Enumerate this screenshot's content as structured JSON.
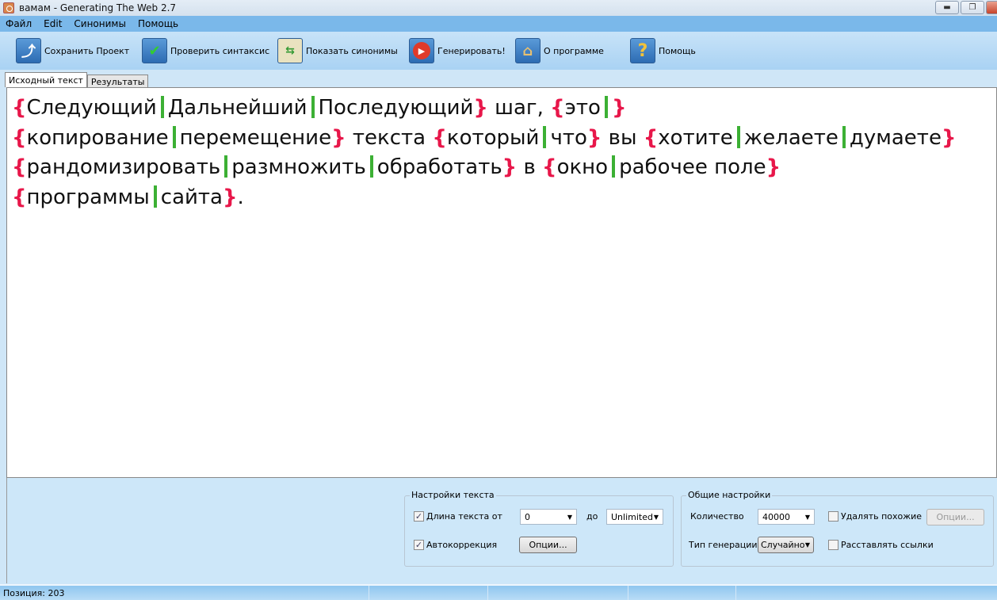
{
  "window": {
    "title": "вамам - Generating The Web 2.7"
  },
  "menu": [
    "Файл",
    "Edit",
    "Синонимы",
    "Помощь"
  ],
  "toolbar": [
    {
      "label": "Сохранить Проект",
      "icon": "save-icon"
    },
    {
      "label": "Проверить синтаксис",
      "icon": "checkmark-icon"
    },
    {
      "label": "Показать синонимы",
      "icon": "swap-documents-icon"
    },
    {
      "label": "Генерировать!",
      "icon": "play-icon"
    },
    {
      "label": "О программе",
      "icon": "home-icon"
    },
    {
      "label": "Помощь",
      "icon": "help-icon"
    }
  ],
  "tabs": [
    "Исходный текст",
    "Результаты"
  ],
  "editor": {
    "lines": [
      "{Следующий|Дальнейший|Последующий} шаг, {это|}",
      "{копирование|перемещение} текста {который|что} вы {хотите|желаете|думаете}",
      "{рандомизировать|размножить|обработать} в {окно|рабочее поле}",
      "{программы|сайта}."
    ],
    "colors": {
      "brace": "#e8174a",
      "pipe": "#3cb034"
    }
  },
  "text_settings": {
    "title": "Настройки текста",
    "length_label": "Длина текста от",
    "length_checked": true,
    "from": "0",
    "to_label": "до",
    "to": "Unlimited",
    "autocorrect_label": "Автокоррекция",
    "autocorrect_checked": true,
    "options": "Опции..."
  },
  "general_settings": {
    "title": "Общие настройки",
    "count_label": "Количество",
    "count": "40000",
    "remove_similar_label": "Удалять похожие",
    "remove_similar_checked": false,
    "options": "Опции...",
    "gen_type_label": "Тип генерации",
    "gen_type": "Случайно",
    "links_label": "Расставлять ссылки",
    "links_checked": false
  },
  "status": {
    "position": "Позиция: 203"
  }
}
